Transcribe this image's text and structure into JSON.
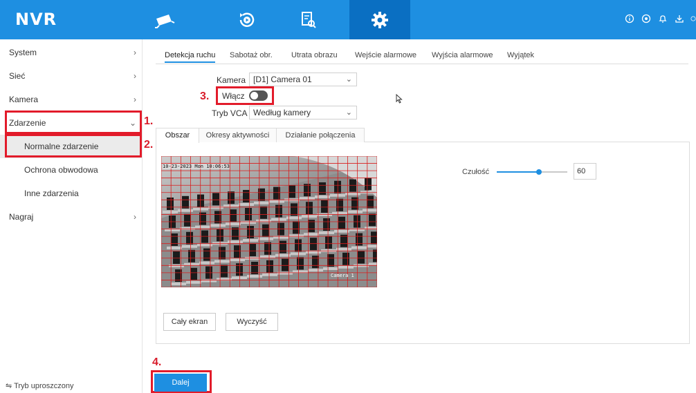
{
  "app": {
    "brand": "NVR"
  },
  "top_nav": [
    {
      "name": "live-view",
      "icon": "camera-icon",
      "active": false
    },
    {
      "name": "playback",
      "icon": "playback-icon",
      "active": false
    },
    {
      "name": "files",
      "icon": "file-search-icon",
      "active": false
    },
    {
      "name": "settings",
      "icon": "gear-icon",
      "active": true
    }
  ],
  "right_icons": [
    "info-icon",
    "target-icon",
    "bell-icon",
    "download-icon",
    "power-icon"
  ],
  "sidebar": {
    "items": [
      {
        "label": "System",
        "chevron": "›"
      },
      {
        "label": "Sieć",
        "chevron": "›"
      },
      {
        "label": "Kamera",
        "chevron": "›"
      },
      {
        "label": "Zdarzenie",
        "chevron": "⌄"
      },
      {
        "label": "Normalne zdarzenie"
      },
      {
        "label": "Ochrona obwodowa"
      },
      {
        "label": "Inne zdarzenia"
      },
      {
        "label": "Nagraj",
        "chevron": "›"
      }
    ],
    "simple_mode": "⇋ Tryb uproszczony"
  },
  "tabs": [
    "Detekcja ruchu",
    "Sabotaż obr.",
    "Utrata obrazu",
    "Wejście alarmowe",
    "Wyjścia alarmowe",
    "Wyjątek"
  ],
  "form": {
    "camera_label": "Kamera",
    "camera_value": "[D1] Camera 01",
    "enable_label": "Włącz",
    "vca_label": "Tryb VCA",
    "vca_value": "Według kamery"
  },
  "subtabs": [
    "Obszar",
    "Okresy aktywności",
    "Działanie połączenia"
  ],
  "video": {
    "timestamp": "10-23-2023 Mon 10:06:53",
    "camera_label": "Camera 1"
  },
  "sensitivity": {
    "label": "Czułość",
    "value": "60",
    "fraction": 0.6
  },
  "buttons": {
    "full_screen": "Cały ekran",
    "clear": "Wyczyść",
    "next": "Dalej"
  },
  "annotations": [
    "1.",
    "2.",
    "3.",
    "4."
  ],
  "colors": {
    "header": "#1e8fe1",
    "active_tab": "#0a6fc2",
    "annotation": "#e21b2a",
    "grid": "#d91c1c"
  }
}
